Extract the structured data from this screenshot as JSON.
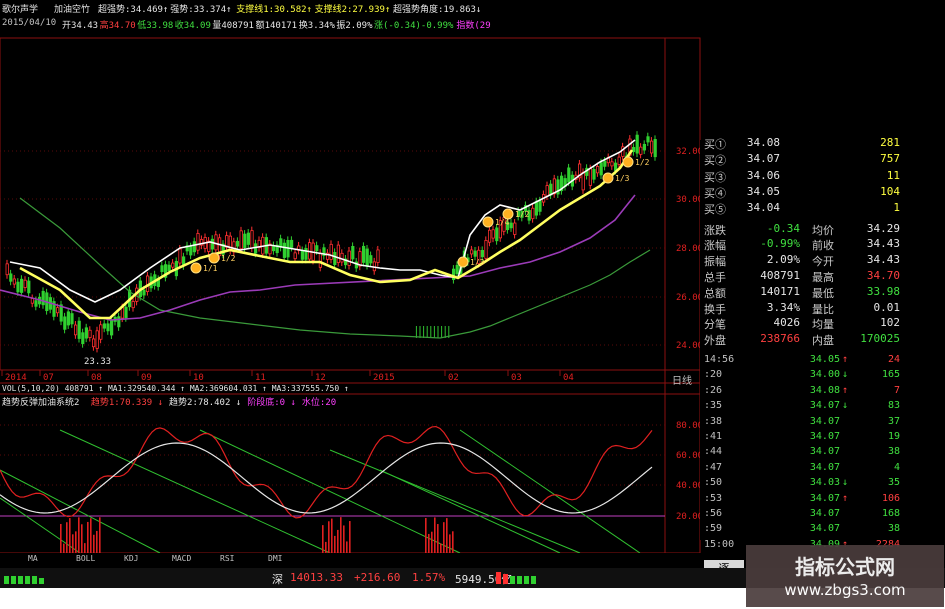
{
  "header": {
    "title_tab": "歌尔声学",
    "indicator_name": "加油空竹",
    "items_row1": [
      {
        "text": "超强势:34.469↑",
        "color": "#e6e6e6"
      },
      {
        "text": "强势:33.374↑",
        "color": "#e6e6e6"
      },
      {
        "text": "支撑线1:30.582↑",
        "color": "#ffff40"
      },
      {
        "text": "支撑线2:27.939↑",
        "color": "#ffff40"
      },
      {
        "text": "超强势角度:19.863↓",
        "color": "#e6e6e6"
      }
    ],
    "items_row2": [
      {
        "text": "2015/04/10",
        "color": "#c0c0c0"
      },
      {
        "text": "开34.43",
        "color": "#e6e6e6"
      },
      {
        "text": "高34.70",
        "color": "#ff4040"
      },
      {
        "text": "低33.98",
        "color": "#40e040"
      },
      {
        "text": "收34.09",
        "color": "#40e040"
      },
      {
        "text": "量408791",
        "color": "#e6e6e6"
      },
      {
        "text": "额140171",
        "color": "#e6e6e6"
      },
      {
        "text": "换3.34%",
        "color": "#e6e6e6"
      },
      {
        "text": "振2.09%",
        "color": "#e6e6e6"
      },
      {
        "text": "涨(-0.34)-0.99%",
        "color": "#40e040"
      },
      {
        "text": "指数(29",
        "color": "#ff40ff"
      }
    ]
  },
  "price_axis": [
    "32.00",
    "30.00",
    "28.00",
    "26.00",
    "24.00"
  ],
  "low_marker": "23.33",
  "signal_labels": [
    "1/1",
    "1/2",
    "1/3",
    "1/4",
    "1/2",
    "1/3",
    "1/2"
  ],
  "x_axis": [
    "2014",
    "07",
    "08",
    "09",
    "10",
    "11",
    "12",
    "2015",
    "02",
    "03",
    "04"
  ],
  "x_axis_unit": "日线",
  "volume_legend": "VOL(5,10,20) 408791 ↑ MA1:329540.344 ↑ MA2:369604.031 ↑ MA3:337555.750 ↑",
  "osc_legend": {
    "name": "趋势反弹加油系统2",
    "items": [
      {
        "text": "趋势1:70.339 ↓",
        "color": "#ff4040"
      },
      {
        "text": "趋势2:78.402 ↓",
        "color": "#e6e6e6"
      },
      {
        "text": "阶段底:0 ↓",
        "color": "#ff40ff"
      },
      {
        "text": "水位:20",
        "color": "#ff40ff"
      }
    ]
  },
  "osc_axis": [
    "80.00",
    "60.00",
    "40.00",
    "20.00"
  ],
  "quote_panel": {
    "asks": [
      {
        "label": "买①",
        "price": "34.08",
        "vol": "281"
      },
      {
        "label": "买②",
        "price": "34.07",
        "vol": "757"
      },
      {
        "label": "买③",
        "price": "34.06",
        "vol": "11"
      },
      {
        "label": "买④",
        "price": "34.05",
        "vol": "104"
      },
      {
        "label": "买⑤",
        "price": "34.04",
        "vol": "1"
      }
    ],
    "stats": [
      {
        "l1": "涨跌",
        "v1": "-0.34",
        "c1": "green",
        "l2": "均价",
        "v2": "34.29",
        "c2": "white"
      },
      {
        "l1": "涨幅",
        "v1": "-0.99%",
        "c1": "green",
        "l2": "前收",
        "v2": "34.43",
        "c2": "white"
      },
      {
        "l1": "振幅",
        "v1": "2.09%",
        "c1": "white",
        "l2": "今开",
        "v2": "34.43",
        "c2": "white"
      },
      {
        "l1": "总手",
        "v1": "408791",
        "c1": "white",
        "l2": "最高",
        "v2": "34.70",
        "c2": "red"
      },
      {
        "l1": "总额",
        "v1": "140171",
        "c1": "white",
        "l2": "最低",
        "v2": "33.98",
        "c2": "green"
      },
      {
        "l1": "换手",
        "v1": "3.34%",
        "c1": "white",
        "l2": "量比",
        "v2": "0.01",
        "c2": "white"
      },
      {
        "l1": "分笔",
        "v1": "4026",
        "c1": "white",
        "l2": "均量",
        "v2": "102",
        "c2": "white"
      },
      {
        "l1": "外盘",
        "v1": "238766",
        "c1": "red",
        "l2": "内盘",
        "v2": "170025",
        "c2": "green"
      }
    ],
    "ticks": [
      {
        "time": "14:56",
        "price": "34.05",
        "dir": "↑",
        "vol": "24",
        "vc": "red"
      },
      {
        "time": ":20",
        "price": "34.00",
        "dir": "↓",
        "vol": "165",
        "vc": "green"
      },
      {
        "time": ":26",
        "price": "34.08",
        "dir": "↑",
        "vol": "7",
        "vc": "red"
      },
      {
        "time": ":35",
        "price": "34.07",
        "dir": "↓",
        "vol": "83",
        "vc": "green"
      },
      {
        "time": ":38",
        "price": "34.07",
        "dir": "",
        "vol": "37",
        "vc": "green"
      },
      {
        "time": ":41",
        "price": "34.07",
        "dir": "",
        "vol": "19",
        "vc": "green"
      },
      {
        "time": ":44",
        "price": "34.07",
        "dir": "",
        "vol": "38",
        "vc": "green"
      },
      {
        "time": ":47",
        "price": "34.07",
        "dir": "",
        "vol": "4",
        "vc": "green"
      },
      {
        "time": ":50",
        "price": "34.03",
        "dir": "↓",
        "vol": "35",
        "vc": "green"
      },
      {
        "time": ":53",
        "price": "34.07",
        "dir": "↑",
        "vol": "106",
        "vc": "red"
      },
      {
        "time": ":56",
        "price": "34.07",
        "dir": "",
        "vol": "168",
        "vc": "green"
      },
      {
        "time": ":59",
        "price": "34.07",
        "dir": "",
        "vol": "38",
        "vc": "green"
      },
      {
        "time": "15:00",
        "price": "34.09",
        "dir": "↑",
        "vol": "2284",
        "vc": "red"
      }
    ],
    "bottom_tab": "逐"
  },
  "tabs": [
    "MA",
    "BOLL",
    "KDJ",
    "MACD",
    "RSI",
    "DMI"
  ],
  "status": {
    "market": "深",
    "index": "14013.33",
    "change": "+216.60",
    "pct": "1.57%",
    "amount": "5949.50亿"
  },
  "watermark": {
    "title": "指标公式网",
    "url": "www.zbgs3.com"
  },
  "colors": {
    "background": "#000000",
    "up": "#ff4040",
    "down": "#40e040",
    "grid_red": "#a01010",
    "ma_white": "#ffffff",
    "ma_yellow": "#ffff60",
    "ma_purple": "#a040c0",
    "ma_green": "#40a040"
  }
}
